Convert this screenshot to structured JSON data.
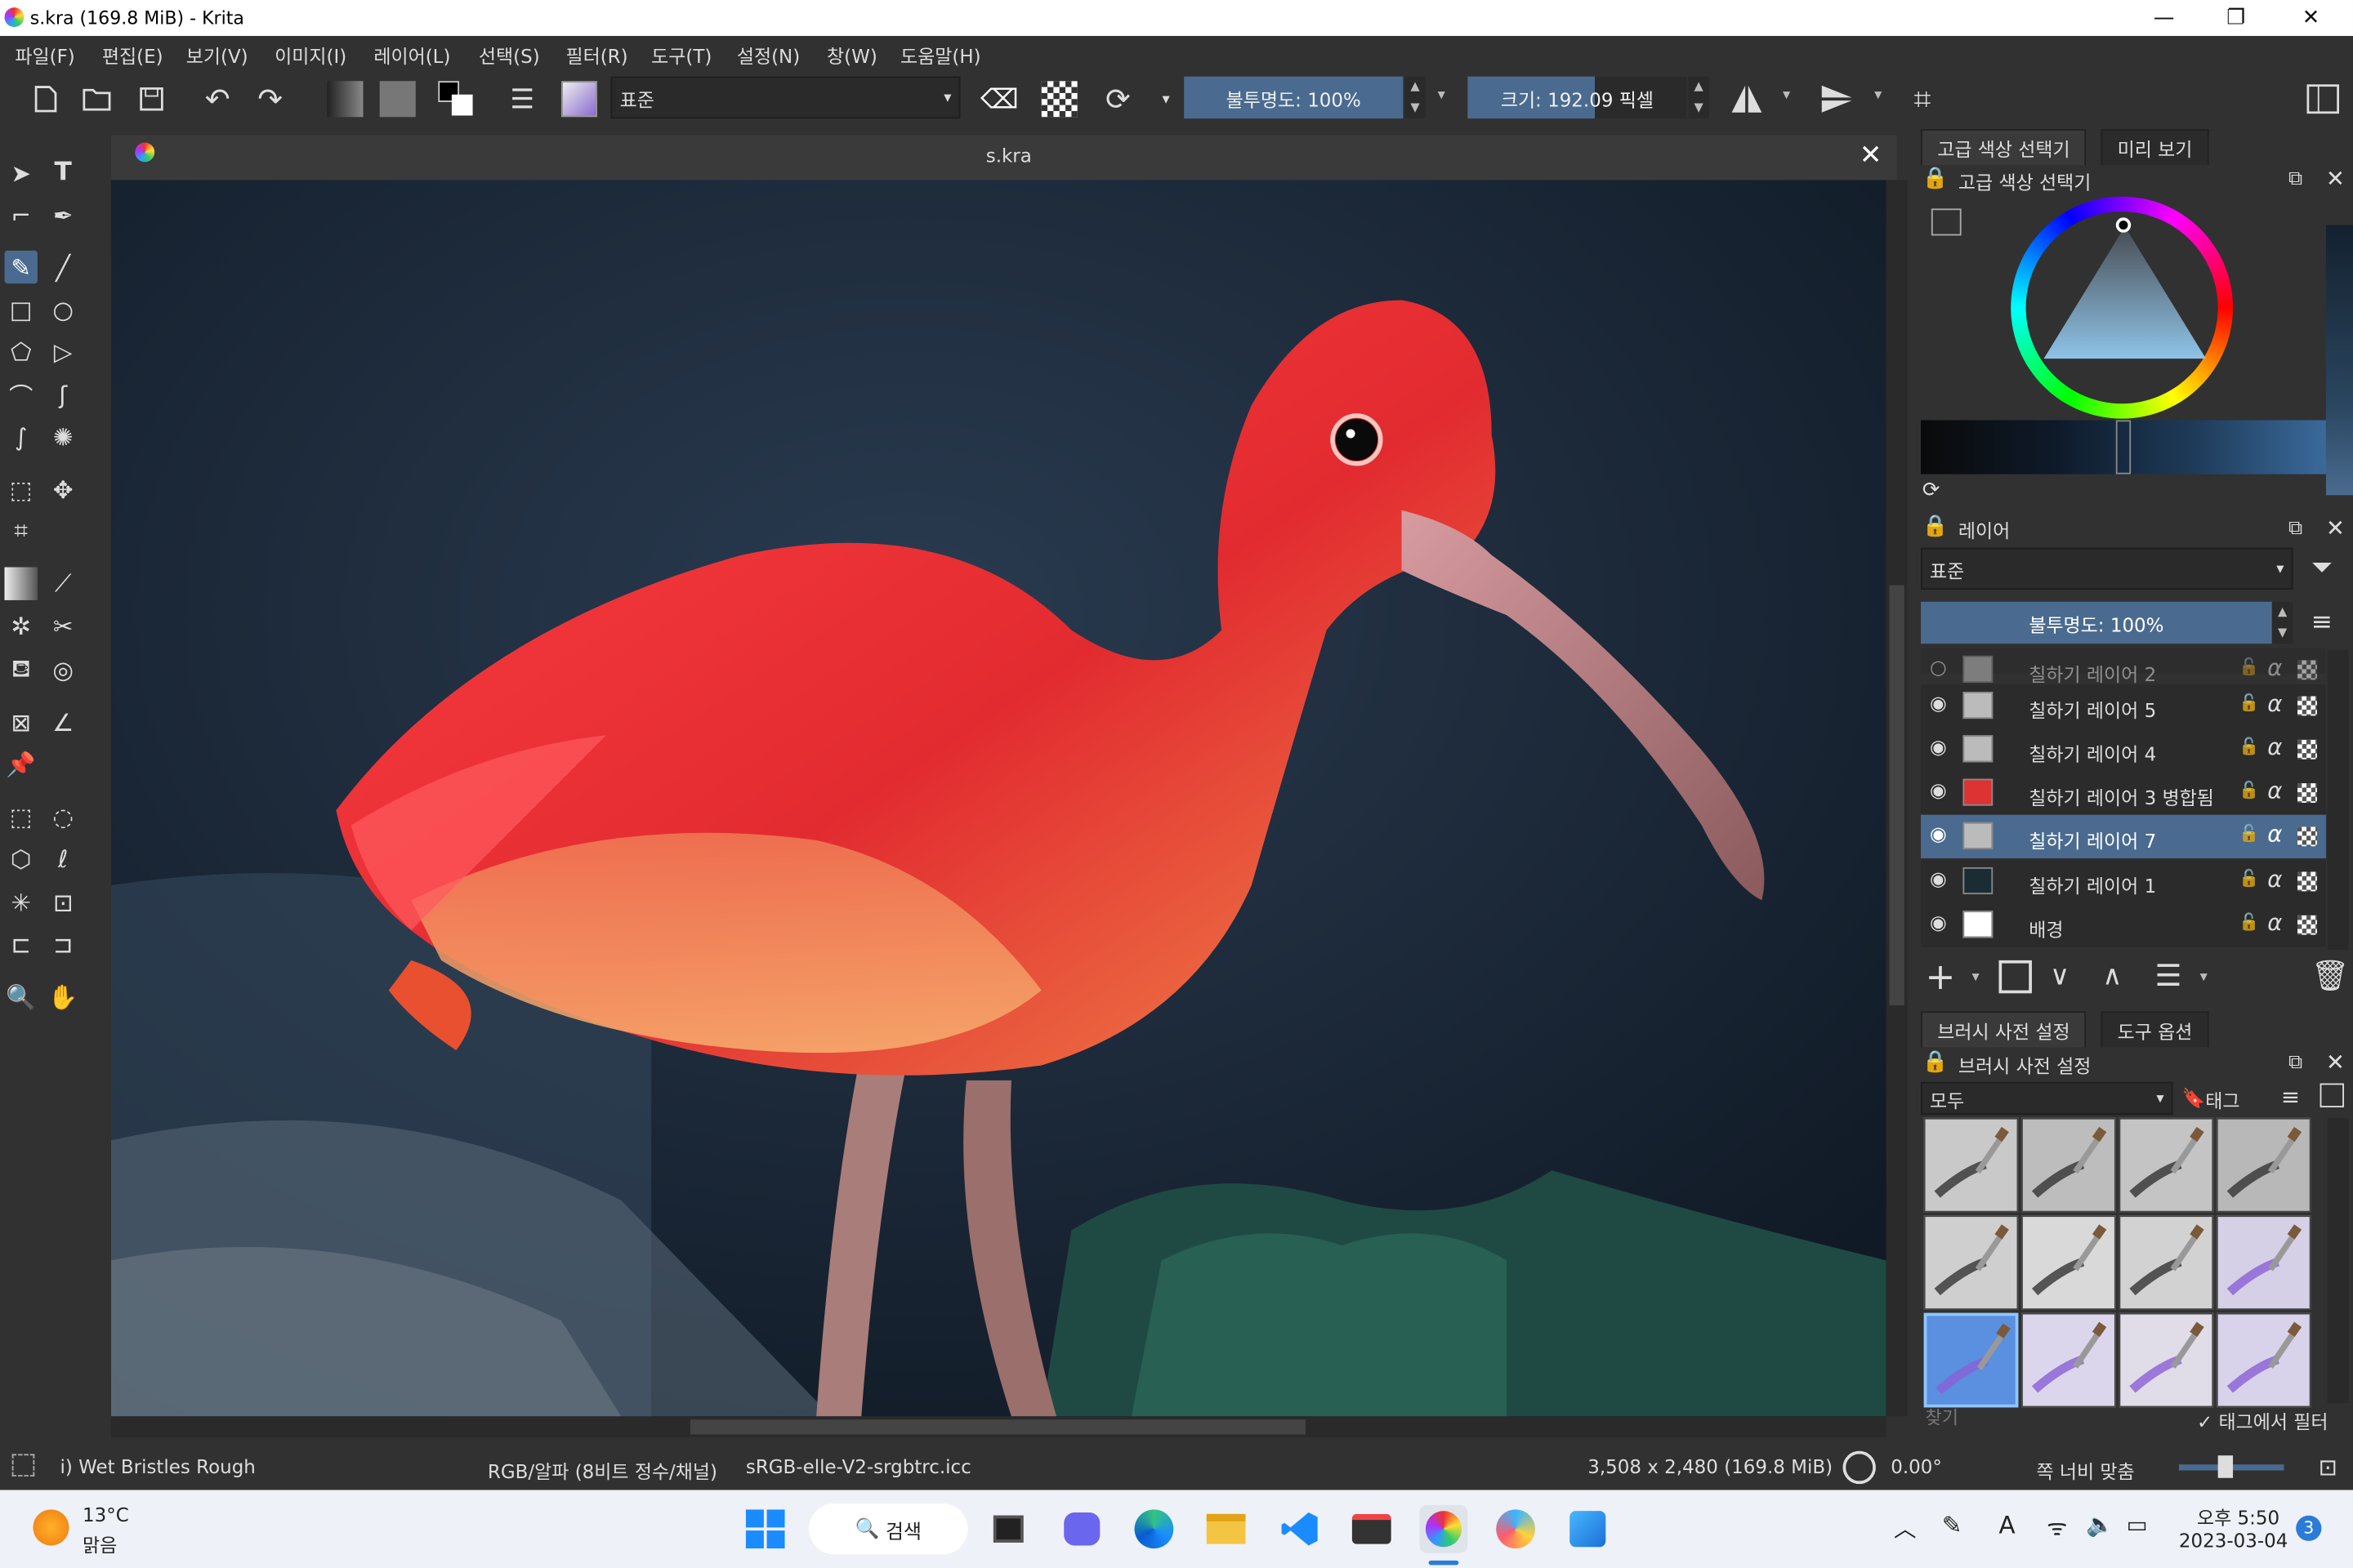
{
  "window": {
    "title": "s.kra (169.8 MiB)  - Krita"
  },
  "menu": [
    "파일(F)",
    "편집(E)",
    "보기(V)",
    "이미지(I)",
    "레이어(L)",
    "선택(S)",
    "필터(R)",
    "도구(T)",
    "설정(N)",
    "창(W)",
    "도움말(H)"
  ],
  "toolbar": {
    "blend_mode": "표준",
    "opacity_label": "불투명도: 100%",
    "size_label": "크기: 192.09 픽셀",
    "opacity_value": 1.0,
    "size_value": 192.09
  },
  "document": {
    "tab_title": "s.kra"
  },
  "color_panel": {
    "tabs": [
      "고급 색상 선택기",
      "미리 보기"
    ],
    "dock_title": "고급 색상 선택기"
  },
  "layers_panel": {
    "title": "레이어",
    "blend_mode": "표준",
    "opacity_label": "불투명도:  100%",
    "layers": [
      {
        "name": "칠하기 레이어 2",
        "visible": false,
        "selected": false
      },
      {
        "name": "칠하기 레이어 5",
        "visible": true,
        "selected": false
      },
      {
        "name": "칠하기 레이어 4",
        "visible": true,
        "selected": false
      },
      {
        "name": "칠하기 레이어 3 병합됨",
        "visible": true,
        "selected": false
      },
      {
        "name": "칠하기 레이어 7",
        "visible": true,
        "selected": true
      },
      {
        "name": "칠하기 레이어 1",
        "visible": true,
        "selected": false
      },
      {
        "name": "배경",
        "visible": true,
        "selected": false
      }
    ]
  },
  "brush_panel": {
    "tabs": [
      "브러시 사전 설정",
      "도구 옵션"
    ],
    "dock_title": "브러시 사전 설정",
    "filter_combo": "모두",
    "tag_label": "태그",
    "search_placeholder": "찾기",
    "filter_in_tag": "태그에서 필터",
    "filter_in_tag_checked": true
  },
  "status": {
    "brush_name": "i) Wet Bristles Rough",
    "color_model": "RGB/알파 (8비트 정수/채널)",
    "profile": "sRGB-elle-V2-srgbtrc.icc",
    "dimensions": "3,508 x 2,480 (169.8 MiB)",
    "rotation": "0.00°",
    "zoom_mode": "쪽 너비 맞춤"
  },
  "taskbar": {
    "weather_temp": "13°C",
    "weather_desc": "맑음",
    "search_label": "검색",
    "time": "오후 5:50",
    "date": "2023-03-04",
    "notifications": "3"
  },
  "colors": {
    "accent": "#4a6b8f",
    "panel": "#313131",
    "canvas_bg": "#14202c",
    "ibis_red": "#e2373a"
  }
}
